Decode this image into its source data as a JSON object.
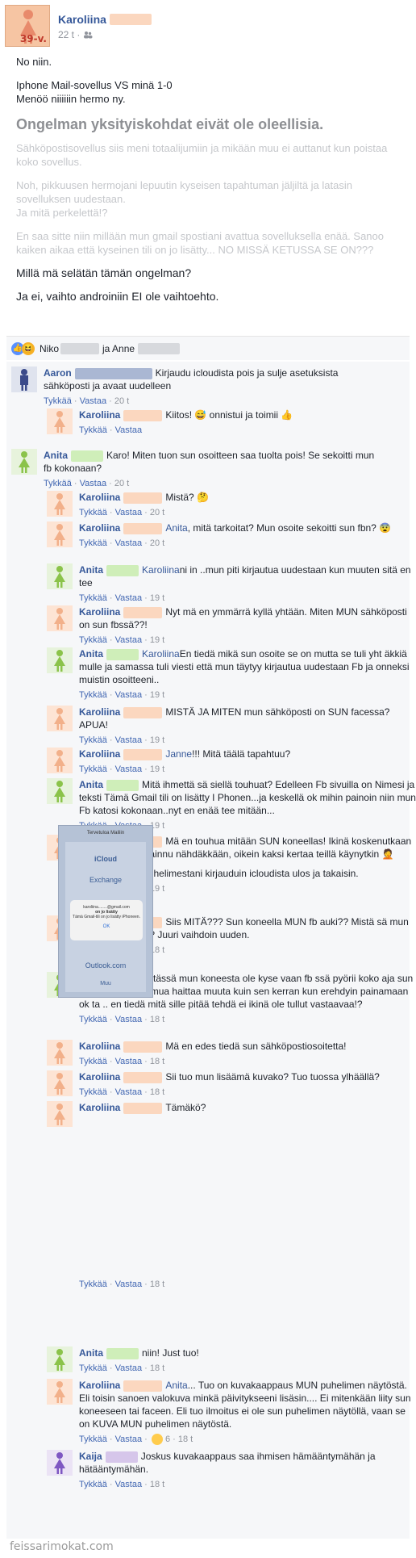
{
  "post": {
    "author": "Karoliina",
    "age_badge": "39-v.",
    "time": "22 t ·",
    "privacy_icon": "friends-icon",
    "lines": {
      "p1": "No niin.",
      "p2a": "Iphone Mail-sovellus VS minä 1-0",
      "p2b": "Menöö niiiiiin hermo ny.",
      "heading": "Ongelman yksityiskohdat eivät ole oleellisia.",
      "faded1": "Sähköpostisovellus siis meni totaalijumiin ja mikään muu ei auttanut kun poistaa koko sovellus.",
      "faded2a": "Noh, pikkuusen hermojani lepuutin kyseisen tapahtuman jäljiltä ja latasin sovelluksen uudestaan.",
      "faded2b": "Ja mitä perkelettä!?",
      "faded3": "En saa sitte niin millään mun gmail spostiani avattua sovelluksella enää. Sanoo kaiken aikaa että kyseinen tili on jo lisätty... NO MISSÄ KETUSSA SE ON???",
      "q1": "Millä mä selätän tämän ongelman?",
      "q2": "Ja ei, vaihto androiniin EI ole vaihtoehto."
    }
  },
  "reactions": {
    "name1": "Niko",
    "sep": "ja Anne"
  },
  "actions": {
    "like": "Tykkää",
    "reply": "Vastaa",
    "dot": "·"
  },
  "comments": [
    {
      "name": "Aaron",
      "color": "#3b4a8a",
      "text": "Kirjaudu icloudista pois ja sulje asetuksista sähköposti ja avaat uudelleen",
      "time": "20 t"
    },
    {
      "name": "Karoliina",
      "color": "#f2b08a",
      "text": "Kiitos! 😅 onnistui ja toimii 👍",
      "time": ""
    },
    {
      "name": "Anita",
      "color": "#8bc34a",
      "text": "Karo! Miten tuon sun osoitteen saa tuolta pois! Se sekoitti mun fb kokonaan?",
      "time": "20 t"
    },
    {
      "name": "Karoliina",
      "color": "#f2b08a",
      "text": "Mistä? 🤔",
      "time": "20 t"
    },
    {
      "name": "Karoliina",
      "color": "#f2b08a",
      "tag": "Anita",
      "text": ", mitä tarkoitat? Mun osoite sekoitti sun fbn? 😨",
      "time": "20 t"
    },
    {
      "name": "Anita",
      "color": "#8bc34a",
      "tag": "Karoliina",
      "text": "ni in ..mun piti kirjautua uudestaan kun muuten sitä en tee",
      "time": "19 t"
    },
    {
      "name": "Karoliina",
      "color": "#f2b08a",
      "text": "Nyt mä en ymmärrä kyllä yhtään. Miten MUN sähköposti on sun fbssä??!",
      "time": "19 t"
    },
    {
      "name": "Anita",
      "color": "#8bc34a",
      "tag": "Karoliina",
      "text": "En tiedä mikä sun osoite se on mutta se tuli yht äkkiä mulle ja samassa tuli viesti että mun täytyy kirjautua uudestaan Fb ja onneksi muistin osoitteeni..",
      "time": "19 t"
    },
    {
      "name": "Karoliina",
      "color": "#f2b08a",
      "text": "MISTÄ JA MITEN mun sähköposti on SUN facessa? APUA!",
      "time": "19 t"
    },
    {
      "name": "Karoliina",
      "color": "#f2b08a",
      "tag": "Janne",
      "text": "!!! Mitä täälä tapahtuu?",
      "time": "19 t"
    },
    {
      "name": "Anita",
      "color": "#8bc34a",
      "text": "Mitä ihmettä sä siellä touhuat? Edelleen Fb sivuilla on Nimesi ja teksti Tämä Gmail tili on lisätty I Phonen...ja keskellä ok mihin painoin niin mun Fb katosi kokonaan..nyt en enää tee mitään...",
      "time": "19 t"
    },
    {
      "name": "Karoliina",
      "color": "#f2b08a",
      "text": "Mä en touhua mitään SUN koneellas! Ikinä koskenutkaan siinen, enkä oo tainnu nähdäkkään, oikein kaksi kertaa teillä käynytkin 🤦",
      "extra": "Ihan OMASTA puhelimestani kirjauduin icloudista ulos ja takaisin.",
      "time": "19 t"
    },
    {
      "name": "Karoliina",
      "color": "#f2b08a",
      "text": "Siis MITÄ??? Sun koneella MUN fb auki?? Mistä sä mun salasanan tiedät? Juuri vaihdoin uuden.",
      "time": "18 t"
    },
    {
      "name": "Anita",
      "color": "#8bc34a",
      "text": "Ei tässä mun koneesta ole kyse vaan fb ssä pyörii koko aja sun tuo osoite! Ei se mua haittaa muuta kuin sen kerran kun erehdyin painamaan ok ta .. en tiedä mitä sille pitää tehdä ei ikinä ole tullut vastaavaa!?",
      "time": "18 t"
    },
    {
      "name": "Karoliina",
      "color": "#f2b08a",
      "text": "Mä en edes tiedä sun sähköpostiosoitetta!",
      "time": "18 t"
    },
    {
      "name": "Karoliina",
      "color": "#f2b08a",
      "text": "Sii tuo mun lisäämä kuvako? Tuo tuossa ylhäällä?",
      "time": "18 t"
    },
    {
      "name": "Karoliina",
      "color": "#f2b08a",
      "text": "Tämäkö?",
      "time": "18 t"
    },
    {
      "name": "Anita",
      "color": "#8bc34a",
      "text": "niin! Just tuo!",
      "time": "18 t"
    },
    {
      "name": "Karoliina",
      "color": "#f2b08a",
      "tag": "Anita",
      "text": "... Tuo on kuvakaappaus MUN puhelimen näytöstä. Eli toisin sanoen valokuva minkä päivitykseeni lisäsin.... Ei mitenkään liity sun koneeseen tai faceen. Eli tuo ilmoitus ei ole sun puhelimen näytöllä, vaan se on KUVA MUN puhelimen näytöstä.",
      "time": "18 t",
      "likes": "6"
    },
    {
      "name": "Kaija",
      "color": "#7e57c2",
      "text": "Joskus kuvakaappaus saa ihmisen hämääntymähän ja hätääntymähän.",
      "time": "18 t"
    }
  ],
  "screenshot": {
    "title": "Tervetuloa Mailiin",
    "row1": "iCloud",
    "row2": "Exchange",
    "dialog_email": "karoliina........@gmail.com",
    "dialog_title": "on jo lisätty",
    "dialog_sub": "Tämä Gmail-tili on jo lisätty iPhoneen.",
    "dialog_ok": "OK",
    "row3": "Outlook.com",
    "row4": "Muu"
  },
  "footer": "feissarimokat.com"
}
